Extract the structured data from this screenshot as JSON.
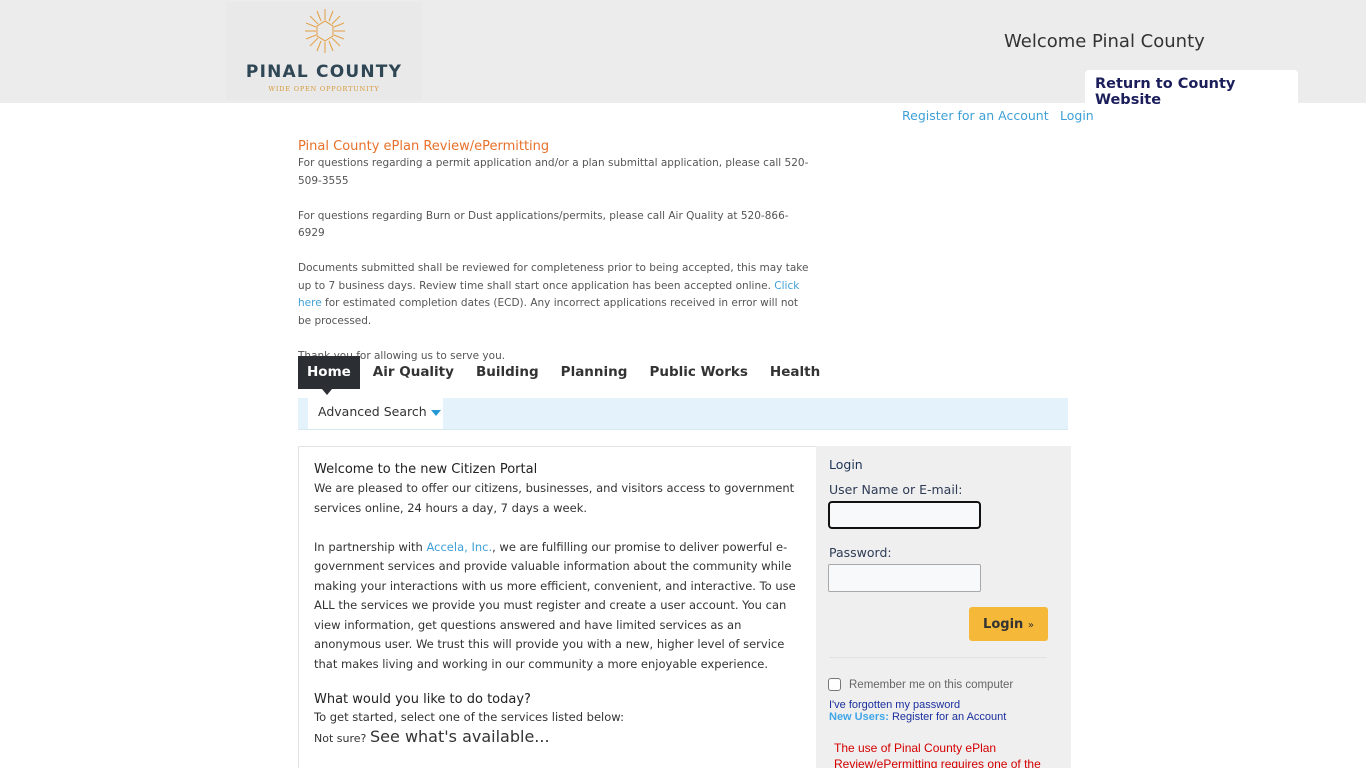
{
  "header": {
    "logo": {
      "title": "PINAL COUNTY",
      "tagline": "WIDE OPEN OPPORTUNITY",
      "icon": "sun-hexagon-logo-icon"
    },
    "welcome": "Welcome Pinal County",
    "return_link": "Return to County Website"
  },
  "top_links": {
    "register": "Register for an Account",
    "login": "Login"
  },
  "intro": {
    "title": "Pinal County ePlan Review/ePermitting",
    "para1": "For questions regarding a permit application and/or a plan submittal application, please call 520-509-3555",
    "para2": "For questions regarding Burn or Dust applications/permits, please call Air Quality at 520-866-6929",
    "para3_before": "Documents submitted shall be reviewed for completeness prior to being accepted, this may take up to 7 business days.  Review time shall start once application has been accepted online.  ",
    "para3_link": "Click here",
    "para3_after": " for estimated completion dates (ECD).  Any incorrect applications received in error will not be processed.",
    "para4": "Thank you for allowing us to serve you."
  },
  "nav": {
    "tabs": [
      {
        "label": "Home",
        "active": true
      },
      {
        "label": "Air Quality",
        "active": false
      },
      {
        "label": "Building",
        "active": false
      },
      {
        "label": "Planning",
        "active": false
      },
      {
        "label": "Public Works",
        "active": false
      },
      {
        "label": "Health",
        "active": false
      }
    ],
    "advanced_search": "Advanced Search"
  },
  "main": {
    "welcome_title": "Welcome to the new Citizen Portal",
    "welcome_text": "We are pleased to offer our citizens, businesses, and visitors access to government services online, 24 hours a day, 7 days a week.",
    "partner_before": "In partnership with ",
    "partner_link": "Accela, Inc.",
    "partner_after": ", we are fulfilling our promise to deliver powerful e-government services and provide valuable information about the community while making your interactions with us more efficient, convenient, and interactive. To use ALL the services we provide you must register and create a user account. You can view information, get questions answered and have limited services as an anonymous user. We trust this will provide you with a new, higher level of service that makes living and working in our community a more enjoyable experience.",
    "todo_title": "What would you like to do today?",
    "todo_text": "To get started, select one of the services listed below:",
    "not_sure": "Not sure?",
    "see_available": "See what's available..."
  },
  "login": {
    "title": "Login",
    "username_label": "User Name or E-mail:",
    "username_value": "",
    "password_label": "Password:",
    "password_value": "",
    "button": "Login",
    "button_suffix": "»",
    "remember": "Remember me on this computer",
    "remember_checked": false,
    "forgot": "I've forgotten my password",
    "new_users_label": "New Users:",
    "new_users_link": "Register for an Account",
    "notice": "The use of Pinal County ePlan Review/ePermitting requires one of the"
  },
  "colors": {
    "accent_orange": "#e8702a",
    "link_blue": "#3fa0d6",
    "login_button": "#f5b838",
    "nav_active": "#2b2f33",
    "notice_red": "#d40000"
  }
}
